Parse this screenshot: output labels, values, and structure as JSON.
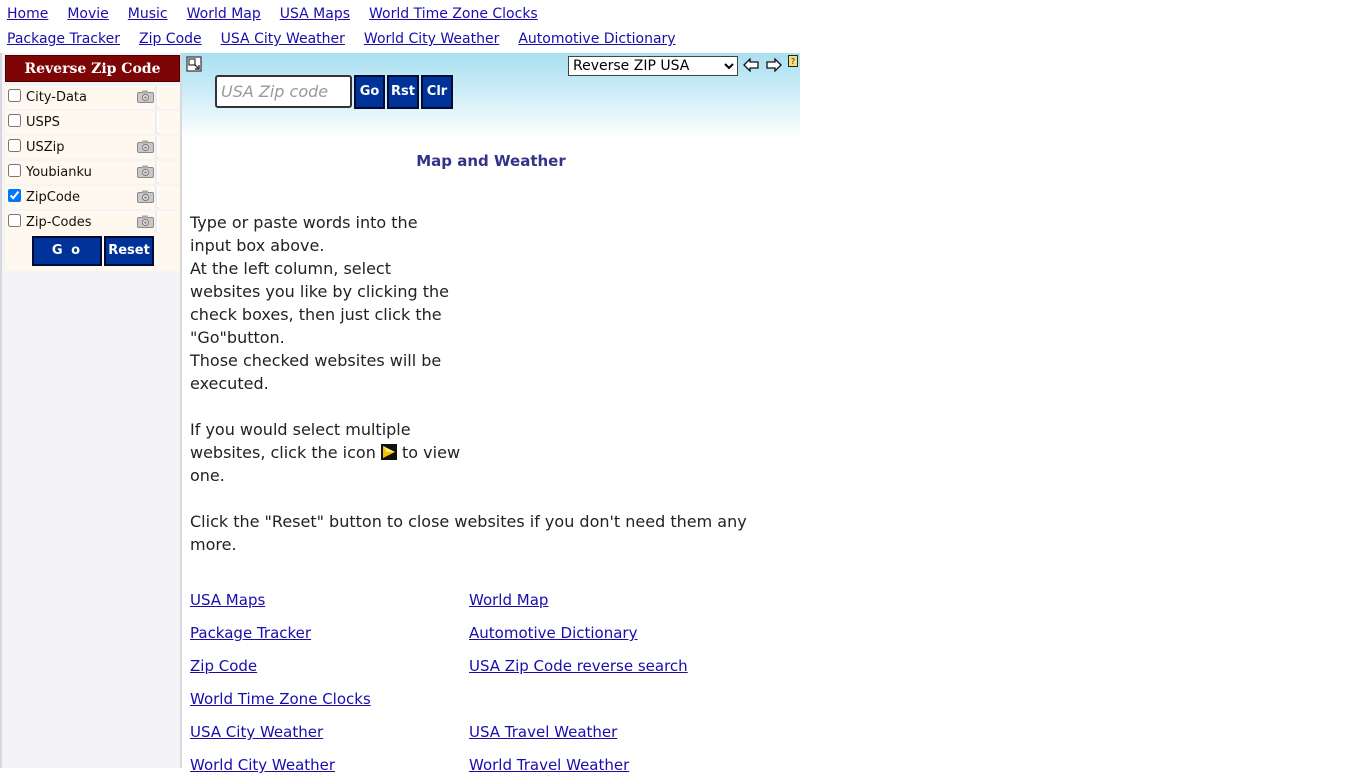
{
  "nav": {
    "row1": [
      "Home",
      "Movie",
      "Music",
      "World Map",
      "USA Maps",
      "World Time Zone Clocks"
    ],
    "row2": [
      "Package Tracker",
      "Zip Code",
      "USA City Weather",
      "World City Weather",
      "Automotive Dictionary"
    ]
  },
  "sidebar": {
    "title": "Reverse Zip Code",
    "sites": [
      {
        "label": "City-Data",
        "checked": false,
        "camera": true
      },
      {
        "label": "USPS",
        "checked": false,
        "camera": false
      },
      {
        "label": "USZip",
        "checked": false,
        "camera": true
      },
      {
        "label": "Youbianku",
        "checked": false,
        "camera": true
      },
      {
        "label": "ZipCode",
        "checked": true,
        "camera": true
      },
      {
        "label": "Zip-Codes",
        "checked": false,
        "camera": true
      }
    ],
    "go_label": "G o",
    "reset_label": "Reset"
  },
  "toolbar": {
    "zip_placeholder": "USA Zip code",
    "zip_value": "",
    "go_label": "Go",
    "rst_label": "Rst",
    "clr_label": "Clr",
    "mode_selected": "Reverse ZIP USA"
  },
  "main": {
    "title": "Map and Weather",
    "p1_lines": [
      "Type or paste words into the input box above.",
      "At the left column, select websites you like by clicking the check boxes, then just click the \"Go\"button.",
      "Those checked websites will be executed."
    ],
    "p2_before": "If you would select multiple websites, click the icon",
    "p2_after": "to view one.",
    "p3": "Click the \"Reset\" button to close websites if you don't need them any more."
  },
  "links": {
    "left": [
      "USA Maps",
      "Package Tracker",
      "Zip Code",
      "World Time Zone Clocks",
      "USA City Weather",
      "World City Weather"
    ],
    "right": [
      "World Map",
      "Automotive Dictionary",
      "USA Zip Code reverse search",
      "",
      "USA Travel Weather",
      "World Travel Weather"
    ]
  },
  "colors": {
    "sidebar_header": "#7d0505",
    "button_blue": "#003399",
    "title_text": "#333388",
    "link": "#1a0dab"
  }
}
